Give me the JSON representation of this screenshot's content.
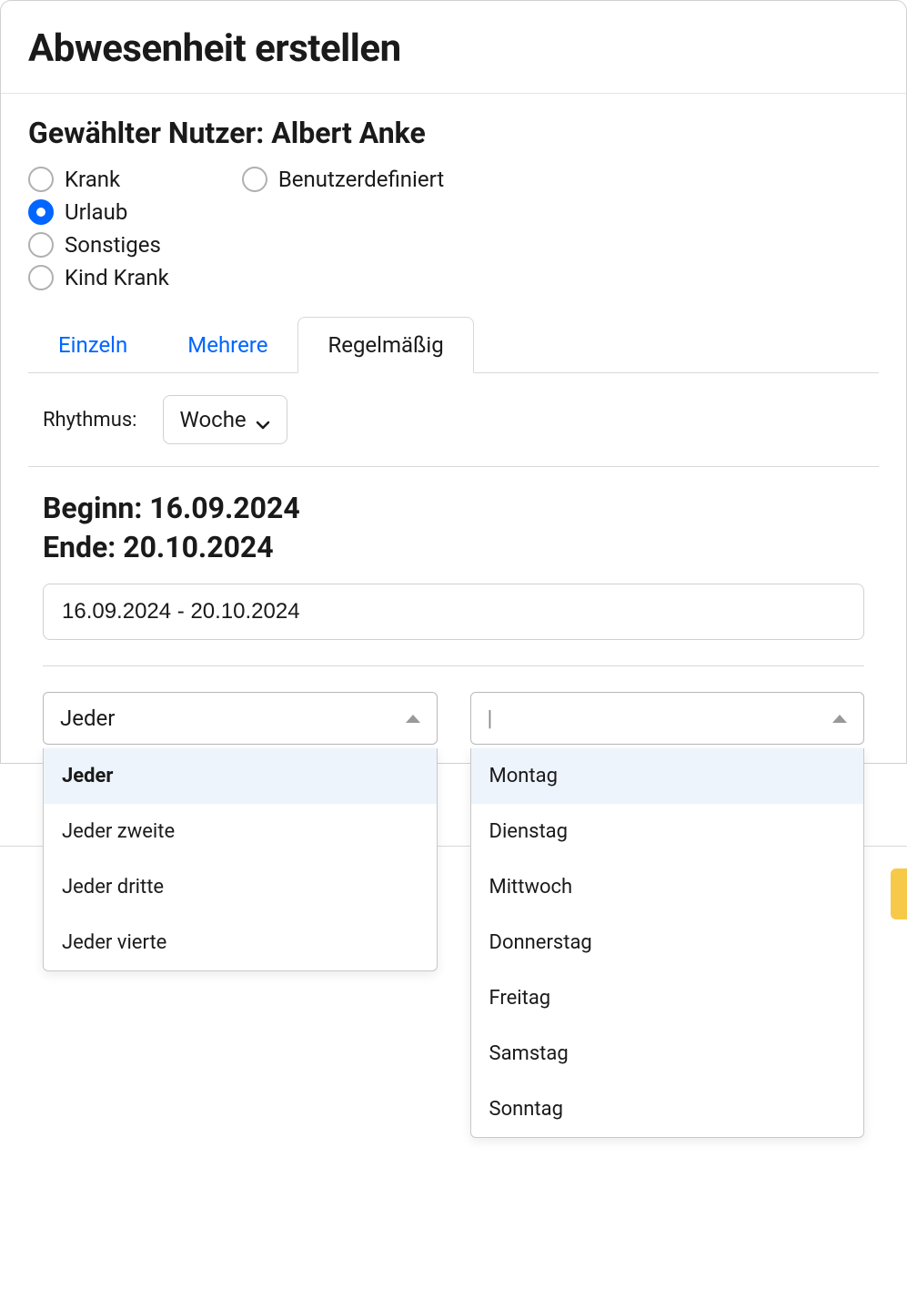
{
  "dialog": {
    "title": "Abwesenheit erstellen",
    "user_heading_prefix": "Gewählter Nutzer: ",
    "user_name": "Albert Anke"
  },
  "absence_types": {
    "col1": [
      {
        "id": "krank",
        "label": "Krank",
        "selected": false
      },
      {
        "id": "urlaub",
        "label": "Urlaub",
        "selected": true
      },
      {
        "id": "sonstiges",
        "label": "Sonstiges",
        "selected": false
      },
      {
        "id": "kind-krank",
        "label": "Kind Krank",
        "selected": false
      }
    ],
    "col2": [
      {
        "id": "benutzerdefiniert",
        "label": "Benutzerdefiniert",
        "selected": false
      }
    ]
  },
  "tabs": [
    {
      "id": "einzeln",
      "label": "Einzeln",
      "active": false
    },
    {
      "id": "mehrere",
      "label": "Mehrere",
      "active": false
    },
    {
      "id": "regelmaessig",
      "label": "Regelmäßig",
      "active": true
    }
  ],
  "rhythmus": {
    "label": "Rhythmus:",
    "value": "Woche"
  },
  "dates": {
    "beginn_label": "Beginn: ",
    "beginn_value": "16.09.2024",
    "ende_label": "Ende: ",
    "ende_value": "20.10.2024",
    "range_display": "16.09.2024 - 20.10.2024"
  },
  "frequency_combo": {
    "value": "Jeder",
    "options": [
      {
        "label": "Jeder",
        "selected": true,
        "highlighted": true
      },
      {
        "label": "Jeder zweite",
        "selected": false,
        "highlighted": false
      },
      {
        "label": "Jeder dritte",
        "selected": false,
        "highlighted": false
      },
      {
        "label": "Jeder vierte",
        "selected": false,
        "highlighted": false
      }
    ]
  },
  "weekday_combo": {
    "value": "",
    "options": [
      {
        "label": "Montag",
        "highlighted": true
      },
      {
        "label": "Dienstag",
        "highlighted": false
      },
      {
        "label": "Mittwoch",
        "highlighted": false
      },
      {
        "label": "Donnerstag",
        "highlighted": false
      },
      {
        "label": "Freitag",
        "highlighted": false
      },
      {
        "label": "Samstag",
        "highlighted": false
      },
      {
        "label": "Sonntag",
        "highlighted": false
      }
    ]
  }
}
